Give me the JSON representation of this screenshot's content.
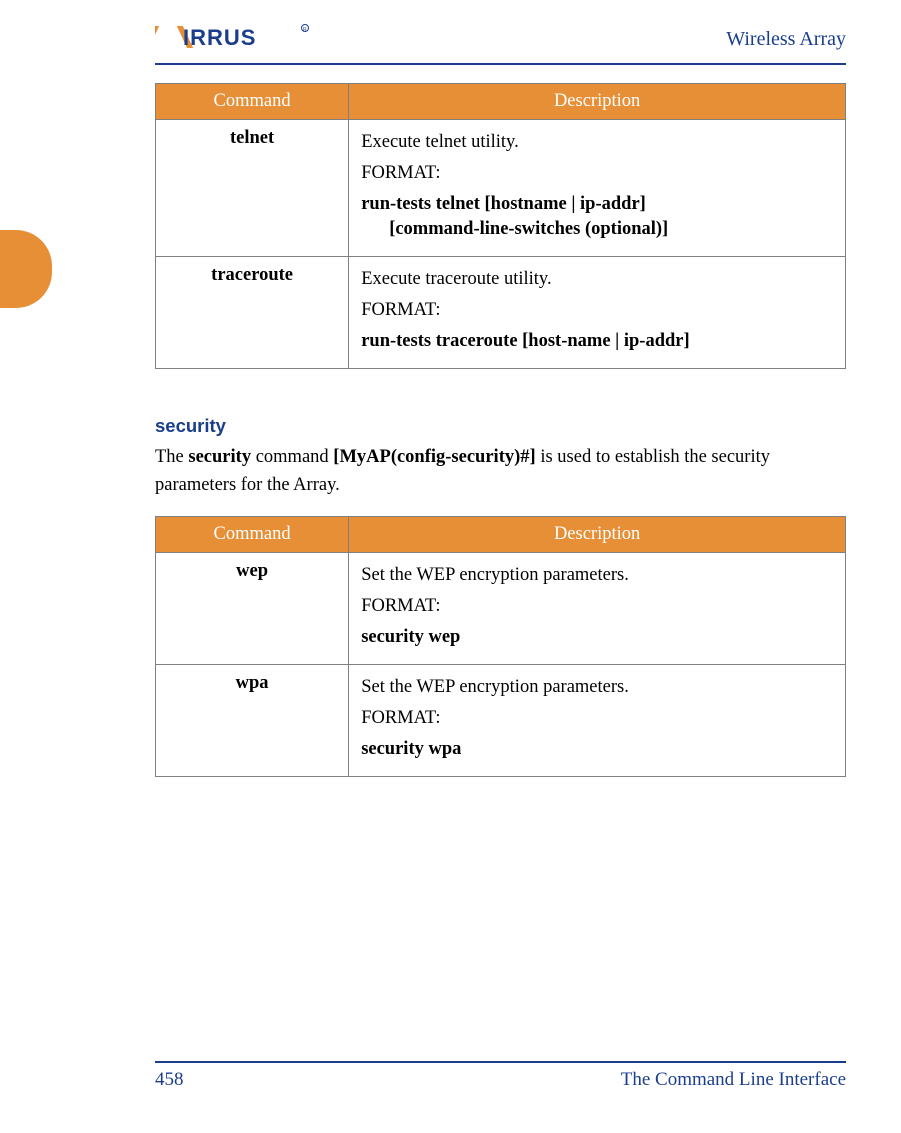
{
  "header": {
    "title": "Wireless Array",
    "logo_text": "XIRRUS"
  },
  "table1": {
    "headers": {
      "command": "Command",
      "description": "Description"
    },
    "rows": [
      {
        "command": "telnet",
        "desc": " Execute telnet utility.",
        "format_label": "FORMAT:",
        "format_line1": "run-tests telnet [hostname | ip-addr]",
        "format_line2": "[command-line-switches (optional)]"
      },
      {
        "command": "traceroute",
        "desc": " Execute traceroute utility.",
        "format_label": "FORMAT:",
        "format_line1": "run-tests traceroute [host-name | ip-addr]",
        "format_line2": ""
      }
    ]
  },
  "section": {
    "heading": "security",
    "para_prefix": "The ",
    "para_bold1": "security",
    "para_mid1": " command ",
    "para_bold2": "[MyAP(config-security)#]",
    "para_suffix": " is used to establish the security parameters for the Array."
  },
  "table2": {
    "headers": {
      "command": "Command",
      "description": "Description"
    },
    "rows": [
      {
        "command": "wep",
        "desc": "Set the WEP encryption parameters.",
        "format_label": "FORMAT:",
        "format_line1": "security wep",
        "format_line2": ""
      },
      {
        "command": "wpa",
        "desc": "Set the WEP encryption parameters.",
        "format_label": "FORMAT:",
        "format_line1": "security wpa",
        "format_line2": ""
      }
    ]
  },
  "footer": {
    "page_number": "458",
    "title": "The Command Line Interface"
  }
}
